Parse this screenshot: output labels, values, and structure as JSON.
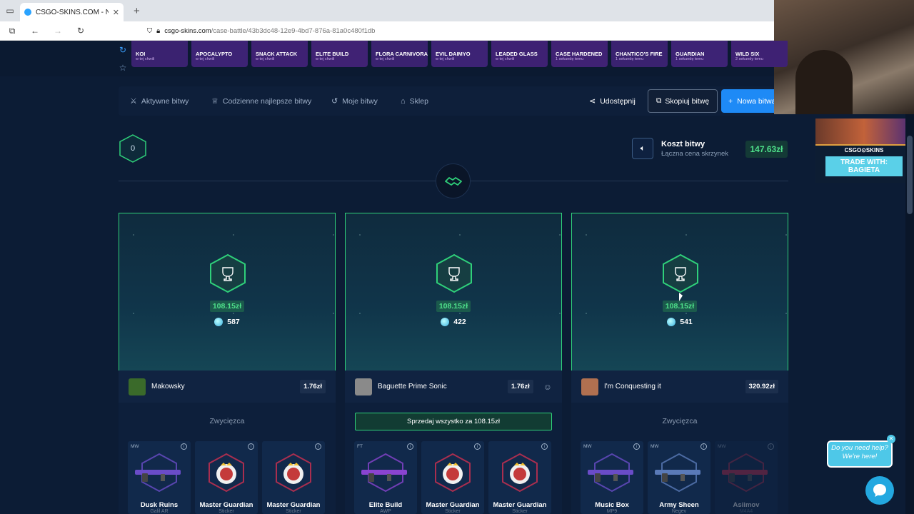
{
  "browser": {
    "tab_title": "CSGO-SKINS.COM - Najlep",
    "url_host": "csgo-skins.com",
    "url_path": "/case-battle/43b3dc48-12e9-4bd7-876a-81a0c480f1db"
  },
  "drops": [
    {
      "name": "KOI",
      "time": "w tej chwili",
      "color": "#3a2270"
    },
    {
      "name": "APOCALYPTO",
      "time": "w tej chwili",
      "color": "#3d2375"
    },
    {
      "name": "SNACK ATTACK",
      "time": "w tej chwili",
      "color": "#3e2173"
    },
    {
      "name": "ELITE BUILD",
      "time": "w tej chwili",
      "color": "#402274"
    },
    {
      "name": "FLORA CARNIVORA",
      "time": "w tej chwili",
      "color": "#3a2270"
    },
    {
      "name": "EVIL DAIMYO",
      "time": "w tej chwili",
      "color": "#3d2375"
    },
    {
      "name": "LEADED GLASS",
      "time": "w tej chwili",
      "color": "#3e2173"
    },
    {
      "name": "CASE HARDENED",
      "time": "1 sekundę temu",
      "color": "#402274"
    },
    {
      "name": "CHANTICO'S FIRE",
      "time": "1 sekundę temu",
      "color": "#3a2270"
    },
    {
      "name": "GUARDIAN",
      "time": "1 sekundę temu",
      "color": "#3d2375"
    },
    {
      "name": "WILD SIX",
      "time": "2 sekundy temu",
      "color": "#3e2173"
    }
  ],
  "nav": {
    "active": "Aktywne bitwy",
    "daily": "Codzienne najlepsze bitwy",
    "mine": "Moje bitwy",
    "shop": "Sklep",
    "share": "Udostępnij",
    "copy": "Skopiuj bitwę",
    "new": "Nowa bitwa"
  },
  "round": "0",
  "cost": {
    "title": "Koszt bitwy",
    "subtitle": "Łączna cena skrzynek",
    "value": "147.63zł"
  },
  "players": [
    {
      "prize": "108.15zł",
      "coins": "587",
      "name": "Makowsky",
      "value": "1.76zł",
      "avatar_color": "#3a6a2a",
      "status": "Zwycięzca",
      "items": [
        {
          "cond": "MW",
          "name": "Dusk Ruins",
          "sub": "Galil AR",
          "hex": "#6a4cc8",
          "faded": false
        },
        {
          "cond": "",
          "name": "Master Guardian",
          "sub": "Sticker",
          "hex": "#d03050",
          "faded": false
        },
        {
          "cond": "",
          "name": "Master Guardian",
          "sub": "Sticker",
          "hex": "#d03050",
          "faded": false
        }
      ]
    },
    {
      "prize": "108.15zł",
      "coins": "422",
      "name": "Baguette Prime Sonic",
      "value": "1.76zł",
      "avatar_color": "#8a8a8a",
      "sell": "Sprzedaj wszystko za 108.15zł",
      "items": [
        {
          "cond": "FT",
          "name": "Elite Build",
          "sub": "AWP",
          "hex": "#8a44d0",
          "faded": false
        },
        {
          "cond": "",
          "name": "Master Guardian",
          "sub": "Sticker",
          "hex": "#d03050",
          "faded": false
        },
        {
          "cond": "",
          "name": "Master Guardian",
          "sub": "Sticker",
          "hex": "#d03050",
          "faded": false
        }
      ]
    },
    {
      "prize": "108.15zł",
      "coins": "541",
      "name": "I'm Conquesting it",
      "value": "320.92zł",
      "avatar_color": "#b07050",
      "status": "Zwycięzca",
      "items": [
        {
          "cond": "MW",
          "name": "Music Box",
          "sub": "MP9",
          "hex": "#6a4cc8",
          "faded": false
        },
        {
          "cond": "MW",
          "name": "Army Sheen",
          "sub": "Negev",
          "hex": "#5a7ab8",
          "faded": false
        },
        {
          "cond": "MW",
          "name": "Asiimov",
          "sub": "M4A4",
          "hex": "#d03050",
          "faded": true
        }
      ]
    }
  ],
  "promo": {
    "brand": "CSGO⊙SKINS",
    "trade": "TRADE WITH:",
    "trader": "BAGIETA"
  },
  "chat": {
    "line1": "Do you need help?",
    "line2": "We're here!"
  },
  "colors": {
    "accent_green": "#2fd07a",
    "accent_blue": "#1e8af6",
    "bg": "#0c1c35"
  }
}
